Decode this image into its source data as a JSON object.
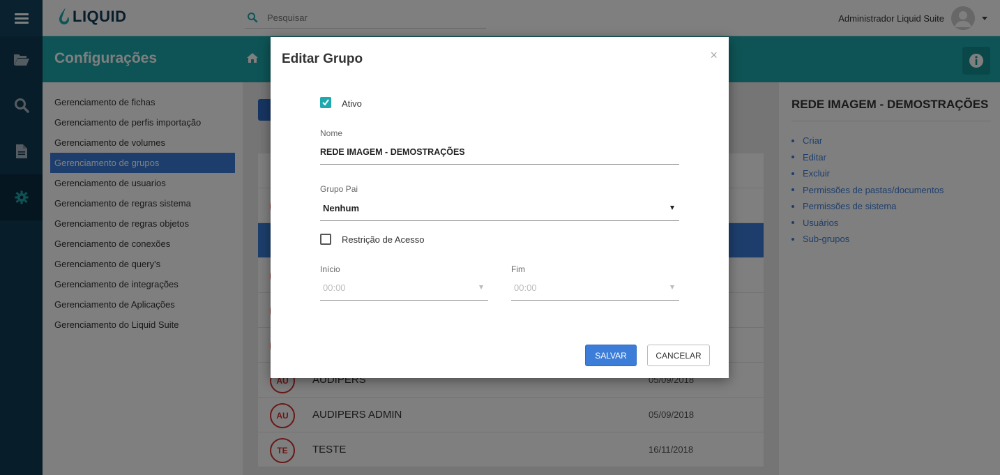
{
  "topbar": {
    "logo_text": "LIQUID",
    "search_placeholder": "Pesquisar",
    "user_name": "Administrador Liquid Suite"
  },
  "header": {
    "title": "Configurações"
  },
  "menu": {
    "items": [
      "Gerenciamento de fichas",
      "Gerenciamento de perfis importação",
      "Gerenciamento de volumes",
      "Gerenciamento de grupos",
      "Gerenciamento de usuarios",
      "Gerenciamento de regras sistema",
      "Gerenciamento de regras objetos",
      "Gerenciamento de conexões",
      "Gerenciamento de query's",
      "Gerenciamento de integrações",
      "Gerenciamento de Aplicações",
      "Gerenciamento do Liquid Suite"
    ],
    "active_index": 3
  },
  "groups": {
    "rows": [
      {
        "badge": "",
        "name": "",
        "date": ""
      },
      {
        "badge": "",
        "name": "",
        "date": ""
      },
      {
        "badge": "",
        "name": "",
        "date": ""
      },
      {
        "badge": "",
        "name": "",
        "date": ""
      },
      {
        "badge": "",
        "name": "",
        "date": ""
      },
      {
        "badge": "",
        "name": "",
        "date": ""
      },
      {
        "badge": "AU",
        "name": "AUDIPERS",
        "date": "05/09/2018"
      },
      {
        "badge": "AU",
        "name": "AUDIPERS ADMIN",
        "date": "05/09/2018"
      },
      {
        "badge": "TE",
        "name": "TESTE",
        "date": "16/11/2018"
      }
    ]
  },
  "right_panel": {
    "title": "REDE IMAGEM - DEMOSTRAÇÕES",
    "links": [
      "Criar",
      "Editar",
      "Excluir",
      "Permissões de pastas/documentos",
      "Permissões de sistema",
      "Usuários",
      "Sub-grupos"
    ]
  },
  "modal": {
    "title": "Editar Grupo",
    "close": "×",
    "ativo_label": "Ativo",
    "ativo_checked": true,
    "nome_label": "Nome",
    "nome_value": "REDE IMAGEM - DEMOSTRAÇÕES",
    "grupo_pai_label": "Grupo Pai",
    "grupo_pai_value": "Nenhum",
    "restricao_label": "Restrição de Acesso",
    "restricao_checked": false,
    "inicio_label": "Início",
    "inicio_value": "00:00",
    "fim_label": "Fim",
    "fim_value": "00:00",
    "save_label": "SALVAR",
    "cancel_label": "CANCELAR"
  },
  "colors": {
    "teal": "#1da9ad",
    "navy": "#0f3a52",
    "blue": "#3b7dd8",
    "red": "#d0312d"
  }
}
